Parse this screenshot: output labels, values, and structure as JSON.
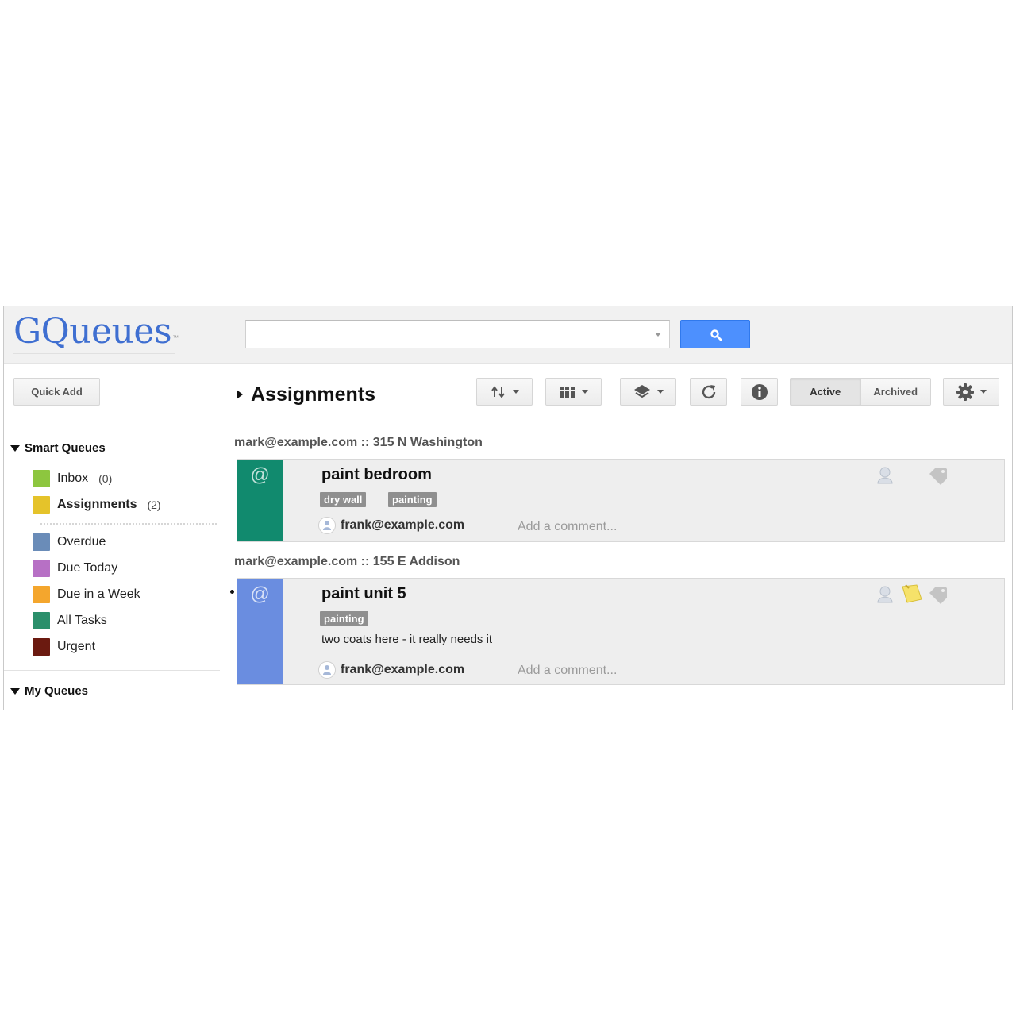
{
  "app": {
    "logo_text": "GQueues",
    "logo_tm": "™",
    "search": {
      "value": "",
      "placeholder": ""
    }
  },
  "toolbar": {
    "quick_add_label": "Quick Add",
    "page_title": "Assignments",
    "sort_icon": "sort-arrows-icon",
    "view_icon": "grid-view-icon",
    "layers_icon": "layers-icon",
    "refresh_icon": "refresh-icon",
    "info_icon": "info-icon",
    "settings_icon": "gear-icon",
    "toggle": {
      "active_label": "Active",
      "archived_label": "Archived",
      "selected": "Active"
    }
  },
  "sidebar": {
    "smart_queues_label": "Smart Queues",
    "smart_queues": [
      {
        "label": "Inbox",
        "count": "(0)",
        "color": "#8dc63f",
        "active": false
      },
      {
        "label": "Assignments",
        "count": "(2)",
        "color": "#e5c32a",
        "active": true
      }
    ],
    "filters": [
      {
        "label": "Overdue",
        "color": "#6a8cb8"
      },
      {
        "label": "Due Today",
        "color": "#b770c5"
      },
      {
        "label": "Due in a Week",
        "color": "#f4a62d"
      },
      {
        "label": "All Tasks",
        "color": "#2b8f6b"
      },
      {
        "label": "Urgent",
        "color": "#6b1a10"
      }
    ],
    "my_queues_label": "My Queues"
  },
  "groups": [
    {
      "header": "mark@example.com :: 315 N Washington",
      "task": {
        "title": "paint bedroom",
        "stripe_color": "#118a6e",
        "at_symbol": "@",
        "tags": [
          "dry wall",
          "painting"
        ],
        "note": "",
        "assignee": "frank@example.com",
        "comment_placeholder": "Add a comment...",
        "has_note_icon": false
      }
    },
    {
      "header": "mark@example.com :: 155 E Addison",
      "task": {
        "title": "paint unit 5",
        "stripe_color": "#6a8de0",
        "at_symbol": "@",
        "tags": [
          "painting"
        ],
        "note": "two coats here - it really needs it",
        "assignee": "frank@example.com",
        "comment_placeholder": "Add a comment...",
        "has_note_icon": true
      }
    }
  ]
}
